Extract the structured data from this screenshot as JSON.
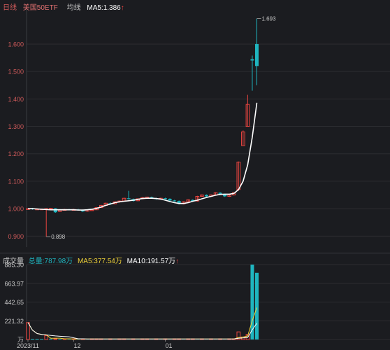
{
  "header": {
    "period": "日线",
    "name": "美国50ETF",
    "ma_label": "均线",
    "ma5": "MA5:1.386",
    "arrow": "↑"
  },
  "volume_header": {
    "label": "成交量",
    "total": "总量:787.98万",
    "ma5": "MA5:377.54万",
    "ma10": "MA10:191.57万",
    "arrow": "↑"
  },
  "colors": {
    "up": "#e8443f",
    "down": "#1fb5bf",
    "ma_price": "#ffffff",
    "ma5_vol": "#f2d43a",
    "ma10_vol": "#ffffff",
    "grid": "#2c2d31",
    "axis_text": "#d25b5b",
    "text": "#c8c8c8"
  },
  "chart_data": [
    {
      "type": "candlestick",
      "title": "",
      "ylim": [
        0.86,
        1.73
      ],
      "yticks": [
        "1.600",
        "1.500",
        "1.400",
        "1.300",
        "1.200",
        "1.100",
        "1.000",
        "0.900"
      ],
      "ytick_values": [
        1.6,
        1.5,
        1.4,
        1.3,
        1.2,
        1.1,
        1.0,
        0.9
      ],
      "xticks": [
        {
          "label": "12",
          "index": 10
        },
        {
          "label": "01",
          "index": 30
        }
      ],
      "annotations": [
        {
          "text": "1.693",
          "index": 50,
          "value": 1.693
        },
        {
          "text": "0.898",
          "index": 4,
          "value": 0.898
        }
      ],
      "candles": [
        [
          1.0,
          1.0,
          1.002,
          0.998
        ],
        [
          1.001,
          0.998,
          1.003,
          0.996
        ],
        [
          0.999,
          0.999,
          1.001,
          0.997
        ],
        [
          0.998,
          0.999,
          1.0,
          0.996
        ],
        [
          0.999,
          1.0,
          1.002,
          0.898
        ],
        [
          1.0,
          1.001,
          1.003,
          0.998
        ],
        [
          1.001,
          0.987,
          1.002,
          0.985
        ],
        [
          0.99,
          0.996,
          0.998,
          0.988
        ],
        [
          0.996,
          0.997,
          0.999,
          0.994
        ],
        [
          0.997,
          0.996,
          0.999,
          0.994
        ],
        [
          0.996,
          0.997,
          0.999,
          0.994
        ],
        [
          0.997,
          0.996,
          0.999,
          0.994
        ],
        [
          0.995,
          0.99,
          0.997,
          0.988
        ],
        [
          0.991,
          0.995,
          0.997,
          0.989
        ],
        [
          0.995,
          0.996,
          0.998,
          0.993
        ],
        [
          0.996,
          1.004,
          1.006,
          0.995
        ],
        [
          1.004,
          1.012,
          1.014,
          1.003
        ],
        [
          1.012,
          1.02,
          1.022,
          1.01
        ],
        [
          1.02,
          1.017,
          1.023,
          1.014
        ],
        [
          1.018,
          1.025,
          1.027,
          1.016
        ],
        [
          1.025,
          1.028,
          1.03,
          1.022
        ],
        [
          1.028,
          1.038,
          1.04,
          1.026
        ],
        [
          1.038,
          1.035,
          1.065,
          1.033
        ],
        [
          1.035,
          1.028,
          1.037,
          1.026
        ],
        [
          1.029,
          1.036,
          1.038,
          1.027
        ],
        [
          1.036,
          1.04,
          1.042,
          1.034
        ],
        [
          1.04,
          1.042,
          1.044,
          1.038
        ],
        [
          1.042,
          1.038,
          1.044,
          1.036
        ],
        [
          1.038,
          1.035,
          1.04,
          1.033
        ],
        [
          1.035,
          1.038,
          1.04,
          1.033
        ],
        [
          1.038,
          1.036,
          1.04,
          1.034
        ],
        [
          1.036,
          1.03,
          1.038,
          1.028
        ],
        [
          1.03,
          1.028,
          1.032,
          1.026
        ],
        [
          1.028,
          1.018,
          1.03,
          1.016
        ],
        [
          1.018,
          1.025,
          1.027,
          1.016
        ],
        [
          1.025,
          1.032,
          1.034,
          1.023
        ],
        [
          1.032,
          1.028,
          1.034,
          1.026
        ],
        [
          1.028,
          1.045,
          1.047,
          1.026
        ],
        [
          1.045,
          1.05,
          1.052,
          1.043
        ],
        [
          1.05,
          1.045,
          1.052,
          1.043
        ],
        [
          1.045,
          1.05,
          1.052,
          1.043
        ],
        [
          1.05,
          1.058,
          1.06,
          1.048
        ],
        [
          1.058,
          1.052,
          1.06,
          1.05
        ],
        [
          1.052,
          1.045,
          1.054,
          1.043
        ],
        [
          1.045,
          1.05,
          1.052,
          1.043
        ],
        [
          1.05,
          1.058,
          1.06,
          1.048
        ],
        [
          1.07,
          1.17,
          1.172,
          1.065
        ],
        [
          1.23,
          1.28,
          1.285,
          1.23
        ],
        [
          1.3,
          1.38,
          1.415,
          1.3
        ],
        [
          1.545,
          1.54,
          1.558,
          1.43
        ],
        [
          1.6,
          1.52,
          1.693,
          1.45
        ]
      ],
      "ma5": [
        1.0,
        1.0,
        0.999,
        0.998,
        0.997,
        0.996,
        0.996,
        0.996,
        0.996,
        0.996,
        0.996,
        0.995,
        0.995,
        0.996,
        0.998,
        1.001,
        1.006,
        1.012,
        1.017,
        1.022,
        1.025,
        1.027,
        1.029,
        1.031,
        1.034,
        1.037,
        1.038,
        1.038,
        1.037,
        1.035,
        1.031,
        1.026,
        1.022,
        1.019,
        1.019,
        1.022,
        1.027,
        1.031,
        1.036,
        1.041,
        1.045,
        1.049,
        1.052,
        1.053,
        1.053,
        1.056,
        1.07,
        1.1,
        1.16,
        1.26,
        1.386
      ]
    },
    {
      "type": "bar",
      "title": "",
      "ylim": [
        0,
        885.3
      ],
      "yticks": [
        "885.30",
        "663.97",
        "442.65",
        "221.32",
        "万"
      ],
      "ytick_values": [
        885.3,
        663.97,
        442.65,
        221.32,
        0
      ],
      "xticks": [
        {
          "label": "2023/11",
          "index": 0
        },
        {
          "label": "12",
          "index": 10
        },
        {
          "label": "01",
          "index": 30
        }
      ],
      "volumes": [
        {
          "v": 200,
          "up": true
        },
        {
          "v": 6,
          "up": false
        },
        {
          "v": 6,
          "up": false
        },
        {
          "v": 8,
          "up": false
        },
        {
          "v": 45,
          "up": true
        },
        {
          "v": 10,
          "up": false
        },
        {
          "v": 8,
          "up": true
        },
        {
          "v": 7,
          "up": false
        },
        {
          "v": 6,
          "up": true
        },
        {
          "v": 8,
          "up": false
        },
        {
          "v": 6,
          "up": true
        },
        {
          "v": 7,
          "up": false
        },
        {
          "v": 6,
          "up": true
        },
        {
          "v": 7,
          "up": false
        },
        {
          "v": 6,
          "up": true
        },
        {
          "v": 8,
          "up": true
        },
        {
          "v": 7,
          "up": true
        },
        {
          "v": 6,
          "up": false
        },
        {
          "v": 7,
          "up": true
        },
        {
          "v": 6,
          "up": false
        },
        {
          "v": 8,
          "up": true
        },
        {
          "v": 6,
          "up": true
        },
        {
          "v": 7,
          "up": false
        },
        {
          "v": 6,
          "up": true
        },
        {
          "v": 7,
          "up": false
        },
        {
          "v": 6,
          "up": true
        },
        {
          "v": 7,
          "up": true
        },
        {
          "v": 6,
          "up": false
        },
        {
          "v": 7,
          "up": true
        },
        {
          "v": 6,
          "up": false
        },
        {
          "v": 8,
          "up": true
        },
        {
          "v": 6,
          "up": false
        },
        {
          "v": 7,
          "up": true
        },
        {
          "v": 6,
          "up": true
        },
        {
          "v": 7,
          "up": false
        },
        {
          "v": 6,
          "up": true
        },
        {
          "v": 7,
          "up": true
        },
        {
          "v": 6,
          "up": false
        },
        {
          "v": 7,
          "up": true
        },
        {
          "v": 6,
          "up": false
        },
        {
          "v": 8,
          "up": true
        },
        {
          "v": 7,
          "up": false
        },
        {
          "v": 6,
          "up": true
        },
        {
          "v": 7,
          "up": false
        },
        {
          "v": 8,
          "up": true
        },
        {
          "v": 6,
          "up": true
        },
        {
          "v": 90,
          "up": true
        },
        {
          "v": 30,
          "up": true
        },
        {
          "v": 60,
          "up": true
        },
        {
          "v": 885.3,
          "up": false
        },
        {
          "v": 787.98,
          "up": false
        }
      ],
      "ma5": [
        200,
        110,
        70,
        60,
        55,
        14,
        16,
        16,
        8,
        8,
        7,
        7,
        7,
        7,
        7,
        7,
        7,
        7,
        7,
        7,
        7,
        7,
        7,
        7,
        7,
        7,
        7,
        7,
        7,
        7,
        7,
        7,
        7,
        7,
        7,
        7,
        7,
        7,
        7,
        7,
        7,
        7,
        7,
        7,
        7,
        7,
        24,
        29,
        42,
        222,
        377.54
      ],
      "ma10": [
        200,
        110,
        70,
        60,
        55,
        48,
        42,
        38,
        35,
        32,
        20,
        8,
        8,
        7,
        7,
        7,
        7,
        7,
        7,
        7,
        7,
        7,
        7,
        7,
        7,
        7,
        7,
        7,
        7,
        7,
        7,
        7,
        7,
        7,
        7,
        7,
        7,
        7,
        7,
        7,
        7,
        7,
        7,
        7,
        7,
        7,
        15,
        18,
        24,
        115,
        191.57
      ]
    }
  ]
}
